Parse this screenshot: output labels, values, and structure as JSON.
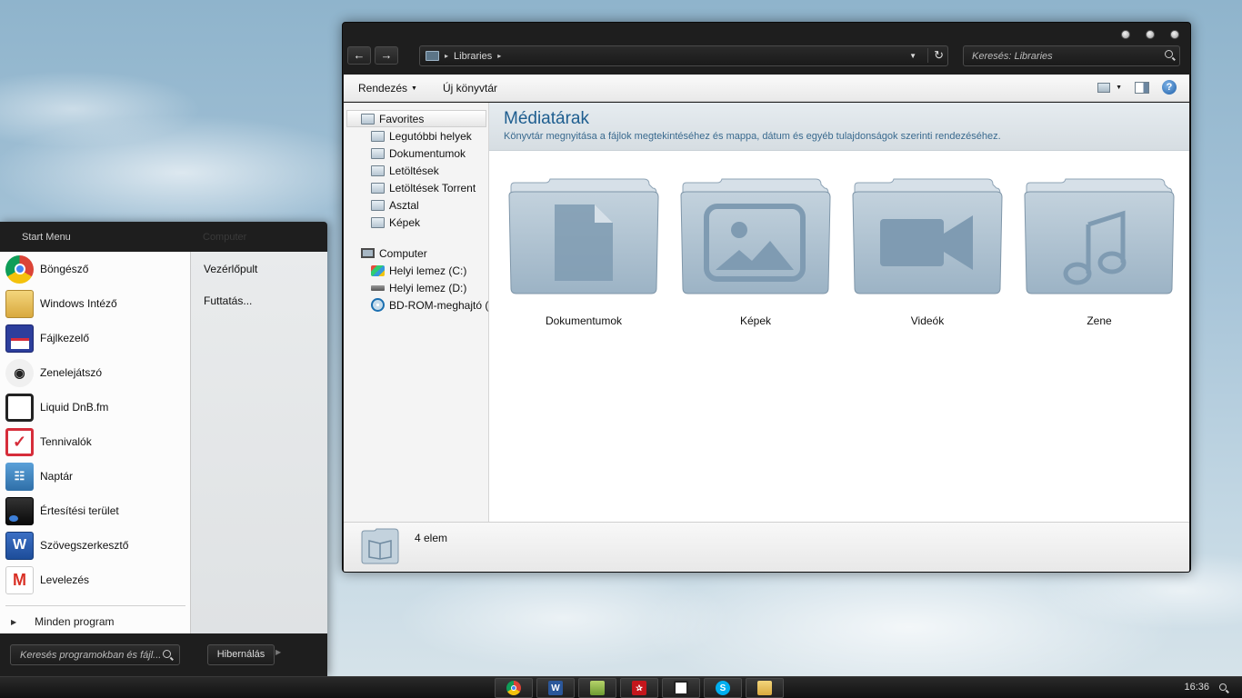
{
  "explorer": {
    "address": {
      "breadcrumb": "Libraries"
    },
    "search": {
      "placeholder": "Keresés: Libraries"
    },
    "toolbar": {
      "organize": "Rendezés",
      "new_library": "Új könyvtár"
    },
    "navpane": {
      "favorites": "Favorites",
      "favorite_items": [
        "Legutóbbi helyek",
        "Dokumentumok",
        "Letöltések",
        "Letöltések Torrent",
        "Asztal",
        "Képek"
      ],
      "computer": "Computer",
      "drives": [
        "Helyi lemez (C:)",
        "Helyi lemez (D:)",
        "BD-ROM-meghajtó (F:)"
      ]
    },
    "content": {
      "title": "Médiatárak",
      "subtitle": "Könyvtár megnyitása a fájlok megtekintéséhez és mappa, dátum és egyéb tulajdonságok szerinti rendezéséhez.",
      "folders": [
        {
          "label": "Dokumentumok",
          "icon": "document-icon"
        },
        {
          "label": "Képek",
          "icon": "picture-icon"
        },
        {
          "label": "Videók",
          "icon": "video-camera-icon"
        },
        {
          "label": "Zene",
          "icon": "music-note-icon"
        }
      ]
    },
    "status": {
      "count": "4 elem"
    }
  },
  "start_menu": {
    "title": "Start Menu",
    "ghost_title": "Computer",
    "apps": [
      {
        "label": "Böngésző",
        "icon": "chrome-icon",
        "color": "#dd4b39"
      },
      {
        "label": "Windows Intéző",
        "icon": "folder-icon",
        "color": "#e6c15a"
      },
      {
        "label": "Fájlkezelő",
        "icon": "floppy-icon",
        "color": "#2d3e9c"
      },
      {
        "label": "Zenelejátszó",
        "icon": "alien-icon",
        "color": "#444444"
      },
      {
        "label": "Liquid DnB.fm",
        "icon": "pipe-icon",
        "color": "#222222"
      },
      {
        "label": "Tennivalók",
        "icon": "checkbox-icon",
        "color": "#d62d3a"
      },
      {
        "label": "Naptár",
        "icon": "calendar-icon",
        "color": "#3d7fb8"
      },
      {
        "label": "Értesítési terület",
        "icon": "monitor-icon",
        "color": "#222222"
      },
      {
        "label": "Szövegszerkesztő",
        "icon": "word-icon",
        "color": "#2b579a"
      },
      {
        "label": "Levelezés",
        "icon": "gmail-icon",
        "color": "#d93025"
      }
    ],
    "all_programs": "Minden program",
    "right_links": [
      "Vezérlőpult",
      "Futtatás..."
    ],
    "search_placeholder": "Keresés programokban és fájl...",
    "hibernate": "Hibernálás"
  },
  "taskbar": {
    "buttons": [
      {
        "icon": "chrome-icon",
        "color": "#dd4b39",
        "glyph": ""
      },
      {
        "icon": "word-icon",
        "color": "#2b579a",
        "glyph": "W"
      },
      {
        "icon": "files-icon",
        "color": "#8cb04a",
        "glyph": ""
      },
      {
        "icon": "pdf-icon",
        "color": "#c4161c",
        "glyph": ""
      },
      {
        "icon": "pipe-icon",
        "color": "#dddddd",
        "glyph": ""
      },
      {
        "icon": "skype-icon",
        "color": "#00aff0",
        "glyph": "S"
      },
      {
        "icon": "explorer-icon",
        "color": "#e6c15a",
        "glyph": ""
      }
    ],
    "clock": "16:36"
  }
}
